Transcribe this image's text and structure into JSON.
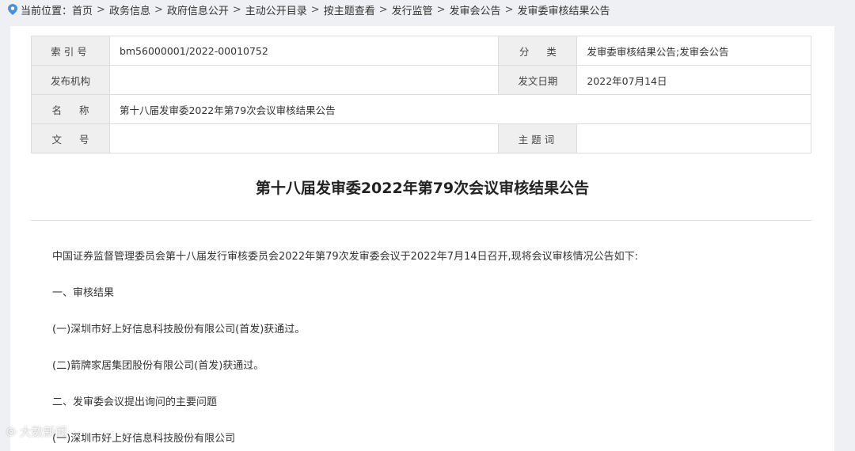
{
  "breadcrumb": {
    "prefix": "当前位置：",
    "items": [
      "首页",
      "政务信息",
      "政府信息公开",
      "主动公开目录",
      "按主题查看",
      "发行监管",
      "发审会公告",
      "发审委审核结果公告"
    ],
    "separator": ">"
  },
  "meta": {
    "index_label": "索引号",
    "index_value": "bm56000001/2022-00010752",
    "category_label": "分类",
    "category_value": "发审委审核结果公告;发审会公告",
    "publisher_label": "发布机构",
    "publisher_value": "",
    "date_label": "发文日期",
    "date_value": "2022年07月14日",
    "name_label": "名称",
    "name_value": "第十八届发审委2022年第79次会议审核结果公告",
    "docno_label": "文号",
    "docno_value": "",
    "subject_label": "主题词",
    "subject_value": ""
  },
  "article": {
    "title": "第十八届发审委2022年第79次会议审核结果公告",
    "paragraphs": [
      "中国证券监督管理委员会第十八届发行审核委员会2022年第79次发审委会议于2022年7月14日召开,现将会议审核情况公告如下:",
      "一、审核结果",
      "(一)深圳市好上好信息科技股份有限公司(首发)获通过。",
      "(二)箭牌家居集团股份有限公司(首发)获通过。",
      "二、发审委会议提出询问的主要问题",
      "(一)深圳市好上好信息科技股份有限公司"
    ]
  },
  "watermark": "大数新闻",
  "colors": {
    "pin": "#4a90d9",
    "label_bg": "#efefef",
    "border": "#dcdcdc"
  }
}
